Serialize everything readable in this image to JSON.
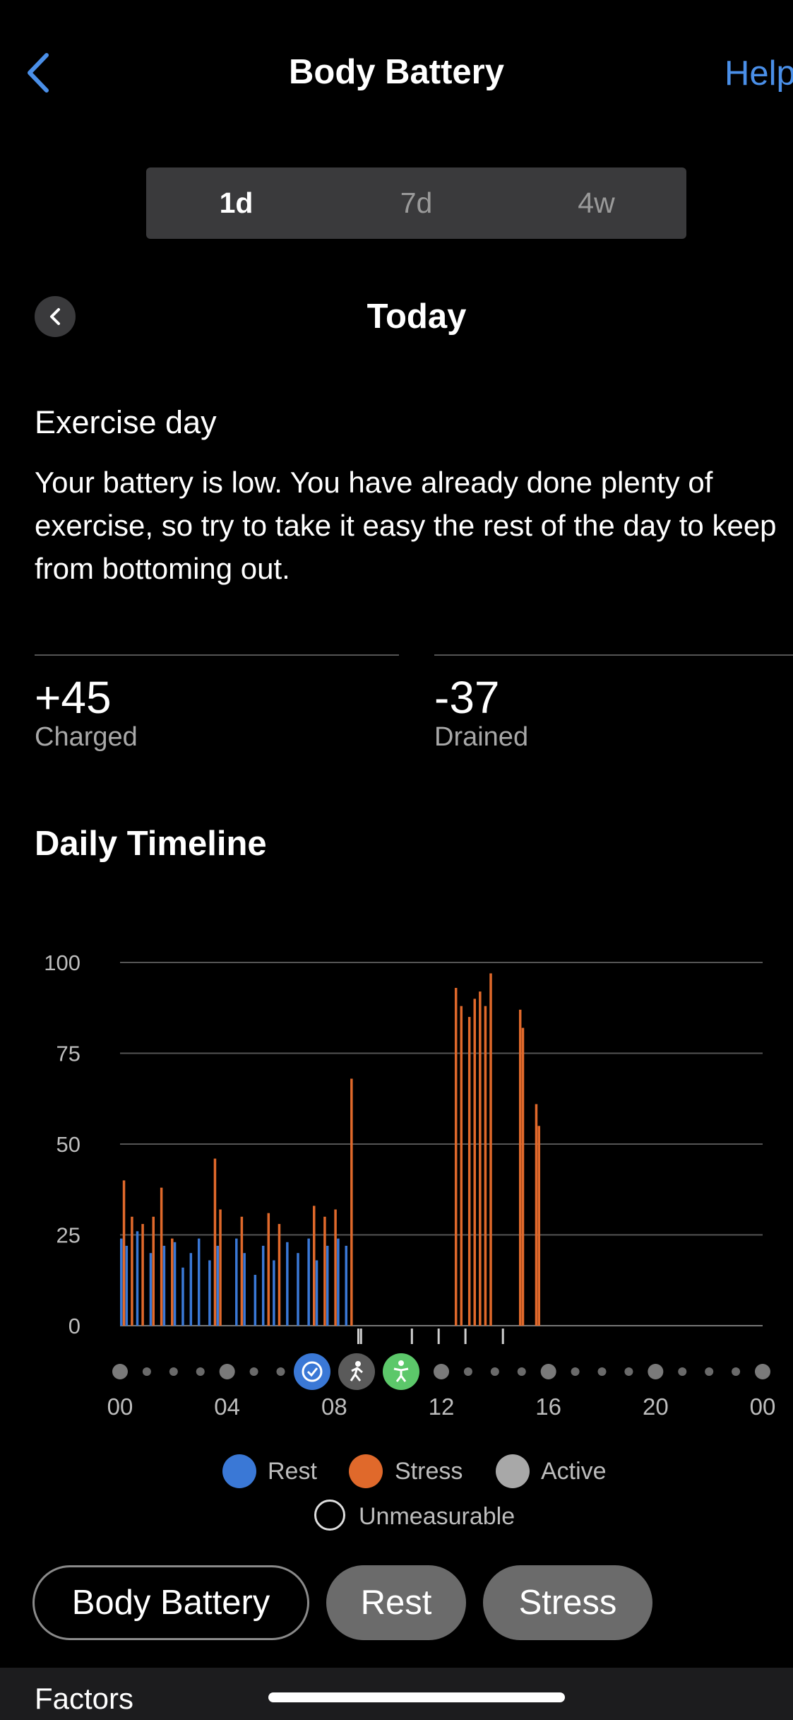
{
  "header": {
    "title": "Body Battery",
    "help_label": "Help"
  },
  "tabs": [
    {
      "label": "1d",
      "active": true
    },
    {
      "label": "7d",
      "active": false
    },
    {
      "label": "4w",
      "active": false
    }
  ],
  "date_label": "Today",
  "status": {
    "title": "Exercise day",
    "text": "Your battery is low. You have already done plenty of exercise, so try to take it easy the rest of the day to keep from bottoming out."
  },
  "stats": {
    "charged_value": "+45",
    "charged_label": "Charged",
    "drained_value": "-37",
    "drained_label": "Drained"
  },
  "timeline_title": "Daily Timeline",
  "legend": {
    "rest": "Rest",
    "stress": "Stress",
    "active": "Active",
    "unmeasurable": "Unmeasurable"
  },
  "colors": {
    "rest": "#3a78d6",
    "stress": "#e0692b",
    "active": "#a8a8a8",
    "accent": "#4a8fe8",
    "activity_green": "#5cc86a"
  },
  "pills": {
    "body_battery": "Body Battery",
    "rest": "Rest",
    "stress": "Stress"
  },
  "factors_label": "Factors",
  "chart_data": {
    "type": "bar",
    "ylim": [
      0,
      100
    ],
    "yticks": [
      "100",
      "75",
      "50",
      "25",
      "0"
    ],
    "xticks": [
      "00",
      "04",
      "08",
      "12",
      "16",
      "20",
      "00"
    ],
    "x_unit": "hour",
    "grid": true,
    "series": [
      {
        "name": "Rest",
        "color": "#3a78d6",
        "bars": [
          [
            0.0,
            24
          ],
          [
            0.2,
            22
          ],
          [
            0.6,
            26
          ],
          [
            1.1,
            20
          ],
          [
            1.6,
            22
          ],
          [
            2.0,
            23
          ],
          [
            2.3,
            16
          ],
          [
            2.6,
            20
          ],
          [
            2.9,
            24
          ],
          [
            3.3,
            18
          ],
          [
            3.6,
            22
          ],
          [
            4.3,
            24
          ],
          [
            4.6,
            20
          ],
          [
            5.0,
            14
          ],
          [
            5.3,
            22
          ],
          [
            5.7,
            18
          ],
          [
            6.2,
            23
          ],
          [
            6.6,
            20
          ],
          [
            7.0,
            24
          ],
          [
            7.3,
            18
          ],
          [
            7.7,
            22
          ],
          [
            8.1,
            24
          ],
          [
            8.4,
            22
          ]
        ]
      },
      {
        "name": "Stress",
        "color": "#e0692b",
        "bars": [
          [
            0.1,
            40
          ],
          [
            0.4,
            30
          ],
          [
            0.8,
            28
          ],
          [
            1.2,
            30
          ],
          [
            1.5,
            38
          ],
          [
            1.9,
            24
          ],
          [
            3.5,
            46
          ],
          [
            3.7,
            32
          ],
          [
            4.5,
            30
          ],
          [
            5.5,
            31
          ],
          [
            5.9,
            28
          ],
          [
            7.2,
            33
          ],
          [
            7.6,
            30
          ],
          [
            8.0,
            32
          ],
          [
            8.6,
            68
          ],
          [
            12.5,
            93
          ],
          [
            12.7,
            88
          ],
          [
            13.0,
            85
          ],
          [
            13.2,
            90
          ],
          [
            13.4,
            92
          ],
          [
            13.6,
            88
          ],
          [
            13.8,
            97
          ],
          [
            14.9,
            87
          ],
          [
            15.0,
            82
          ],
          [
            15.5,
            61
          ],
          [
            15.6,
            55
          ]
        ]
      }
    ]
  }
}
